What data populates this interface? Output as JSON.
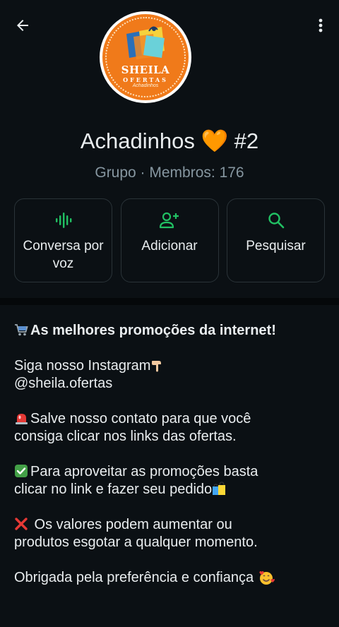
{
  "header": {
    "back_icon": "arrow-left-icon",
    "more_icon": "more-vert-icon"
  },
  "avatar": {
    "brand": "SHEILA",
    "sub": "OFERTAS",
    "tag": "Achadinhos"
  },
  "group": {
    "name": "Achadinhos 🧡 #2",
    "info": "Grupo · Membros: 176"
  },
  "actions": [
    {
      "label_1": "Conversa por",
      "label_2": "voz",
      "icon": "voice-wave-icon"
    },
    {
      "label_1": "Adicionar",
      "icon": "add-person-icon"
    },
    {
      "label_1": "Pesquisar",
      "icon": "search-icon"
    }
  ],
  "description": {
    "headline": "As melhores promoções da internet!",
    "insta_1": "Siga nosso Instagram",
    "insta_2": "@sheila.ofertas",
    "save_1": "Salve nosso contato para que você",
    "save_2": "consiga clicar nos links das ofertas.",
    "promo_1": "Para aproveitar as promoções basta",
    "promo_2": "clicar no link e fazer seu pedido",
    "values_1": " Os valores podem aumentar ou",
    "values_2": "produtos esgotar a qualquer momento.",
    "thanks": "Obrigada pela preferência e confiança "
  },
  "colors": {
    "accent": "#21c063",
    "background": "#0b1014",
    "muted": "#8696a0",
    "avatar_orange": "#f07a1a"
  }
}
